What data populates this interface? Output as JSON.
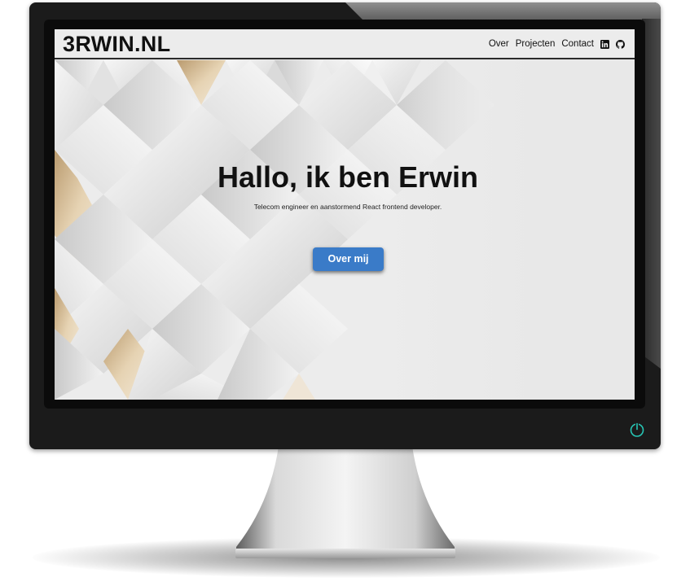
{
  "site": {
    "brand": "3RWIN.NL"
  },
  "nav": {
    "items": [
      {
        "label": "Over"
      },
      {
        "label": "Projecten"
      },
      {
        "label": "Contact"
      }
    ],
    "icons": [
      "linkedin-icon",
      "github-icon"
    ]
  },
  "hero": {
    "title": "Hallo, ik ben Erwin",
    "subtitle": "Telecom engineer en aanstormend React frontend developer.",
    "button_label": "Over mij"
  },
  "colors": {
    "button": "#3a7bc8",
    "power_led": "#27c7b6",
    "accent_tile": "#d9c3a0"
  }
}
